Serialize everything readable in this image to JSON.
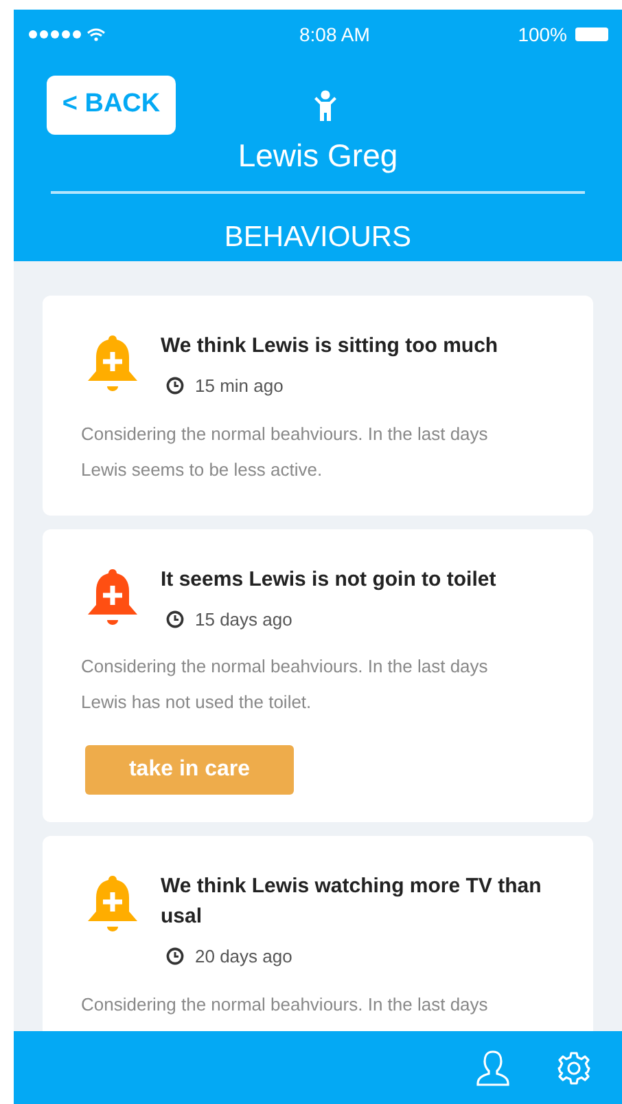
{
  "status_bar": {
    "time": "8:08 AM",
    "battery": "100%"
  },
  "header": {
    "back": "< BACK",
    "name": "Lewis Greg",
    "section": "BEHAVIOURS"
  },
  "alerts": [
    {
      "title": "We think Lewis is sitting too much",
      "time": "15 min ago",
      "body": "Considering the normal beahviours. In the last days Lewis seems to be less active.",
      "color": "#ffad00"
    },
    {
      "title": "It seems Lewis is not goin to toilet",
      "time": "15 days ago",
      "body": "Considering the normal beahviours. In the last days Lewis has not used the toilet.",
      "color": "#ff4f12",
      "action": "take in care"
    },
    {
      "title": "We think Lewis watching more TV than usal",
      "time": "20 days ago",
      "body": "Considering the normal beahviours. In the last days",
      "color": "#ffad00"
    }
  ]
}
